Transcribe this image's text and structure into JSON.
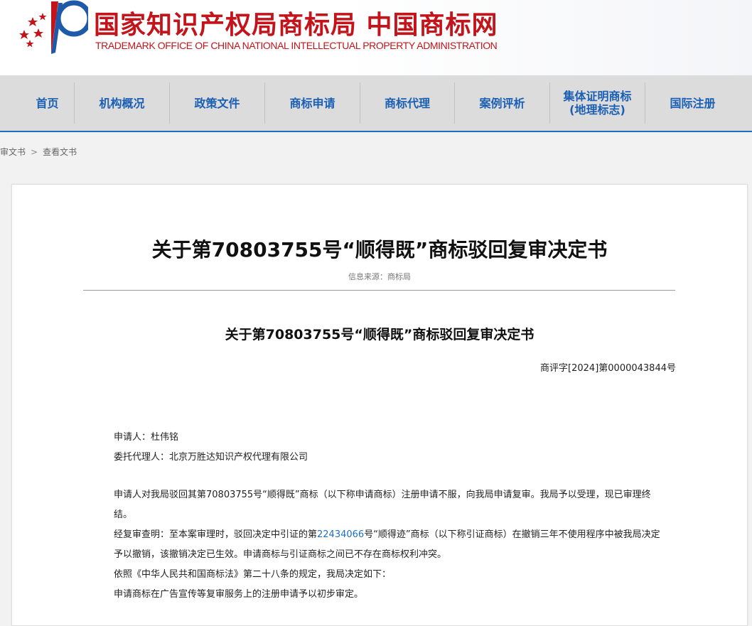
{
  "header": {
    "title_cn": "国家知识产权局商标局 中国商标网",
    "title_en": "TRADEMARK OFFICE OF CHINA NATIONAL INTELLECTUAL PROPERTY ADMINISTRATION",
    "brand_color": "#c4141b"
  },
  "nav": {
    "items": [
      {
        "label": "首页"
      },
      {
        "label": "机构概况"
      },
      {
        "label": "政策文件"
      },
      {
        "label": "商标申请"
      },
      {
        "label": "商标代理"
      },
      {
        "label": "案例评析"
      },
      {
        "label": "集体证明商标\n(地理标志)"
      },
      {
        "label": "国际注册"
      }
    ],
    "accent_color": "#1a5fb4"
  },
  "breadcrumb": {
    "items": [
      "审文书",
      "查看文书"
    ],
    "separator": ">"
  },
  "article": {
    "title": "关于第70803755号“顺得既”商标驳回复审决定书",
    "source": "信息来源：商标局",
    "doc_title": "关于第70803755号“顺得既”商标驳回复审决定书",
    "doc_number": "商评字[2024]第0000043844号",
    "applicant": "申请人：杜伟铭",
    "agent": "委托代理人：北京万胜达知识产权代理有限公司",
    "para1": "申请人对我局驳回其第70803755号“顺得既”商标（以下称申请商标）注册申请不服，向我局申请复审。我局予以受理，现已审理终结。",
    "para2_before": "经复审查明：至本案审理时，驳回决定中引证的第",
    "para2_link": "22434066",
    "para2_after": "号“顺得迹”商标（以下称引证商标）在撤销三年不使用程序中被我局决定予以撤销，该撤销决定已生效。申请商标与引证商标之间已不存在商标权利冲突。",
    "para3": "依照《中华人民共和国商标法》第二十八条的规定，我局决定如下：",
    "para4": "申请商标在广告宣传等复审服务上的注册申请予以初步审定。"
  }
}
